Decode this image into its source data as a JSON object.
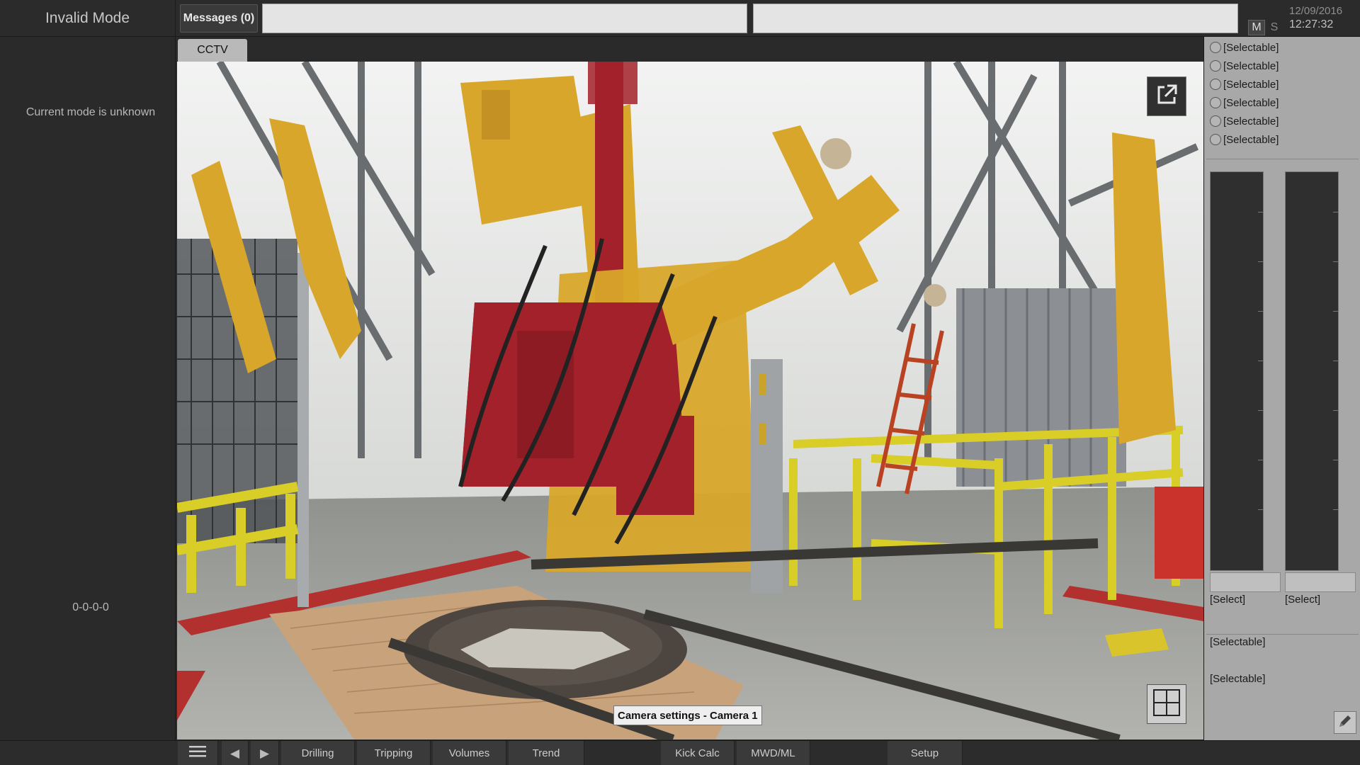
{
  "header": {
    "mode_title": "Invalid Mode",
    "messages_label": "Messages (0)",
    "message_field_1": "",
    "message_field_2": "",
    "m_toggle": "M",
    "s_toggle": "S",
    "date": "12/09/2016",
    "time": "12:27:32"
  },
  "left_panel": {
    "current_mode_text": "Current mode is unknown",
    "mode_code": "0-0-0-0"
  },
  "main": {
    "tab_label": "CCTV",
    "camera_settings_label": "Camera settings - Camera 1",
    "popout_icon": "external-link-icon",
    "grid_icon": "grid-layout-icon"
  },
  "right_panel": {
    "radio_items": [
      {
        "label": "[Selectable]"
      },
      {
        "label": "[Selectable]"
      },
      {
        "label": "[Selectable]"
      },
      {
        "label": "[Selectable]"
      },
      {
        "label": "[Selectable]"
      },
      {
        "label": "[Selectable]"
      }
    ],
    "gauge_selects": [
      "[Select]",
      "[Select]"
    ],
    "lower_selectables": [
      "[Selectable]",
      "[Selectable]"
    ],
    "edit_icon": "pencil-icon"
  },
  "bottom_bar": {
    "menu_icon": "hamburger-menu-icon",
    "prev_icon": "triangle-left-icon",
    "next_icon": "triangle-right-icon",
    "prev_glyph": "◀",
    "next_glyph": "▶",
    "buttons": [
      "Drilling",
      "Tripping",
      "Volumes",
      "Trend",
      "Kick Calc",
      "MWD/ML",
      "Setup"
    ]
  },
  "colors": {
    "background": "#2a2a2a",
    "right_panel": "#a8a8a8",
    "equipment_yellow": "#d8a62a",
    "equipment_red": "#a3212a",
    "railing_yellow": "#d9cd28"
  }
}
